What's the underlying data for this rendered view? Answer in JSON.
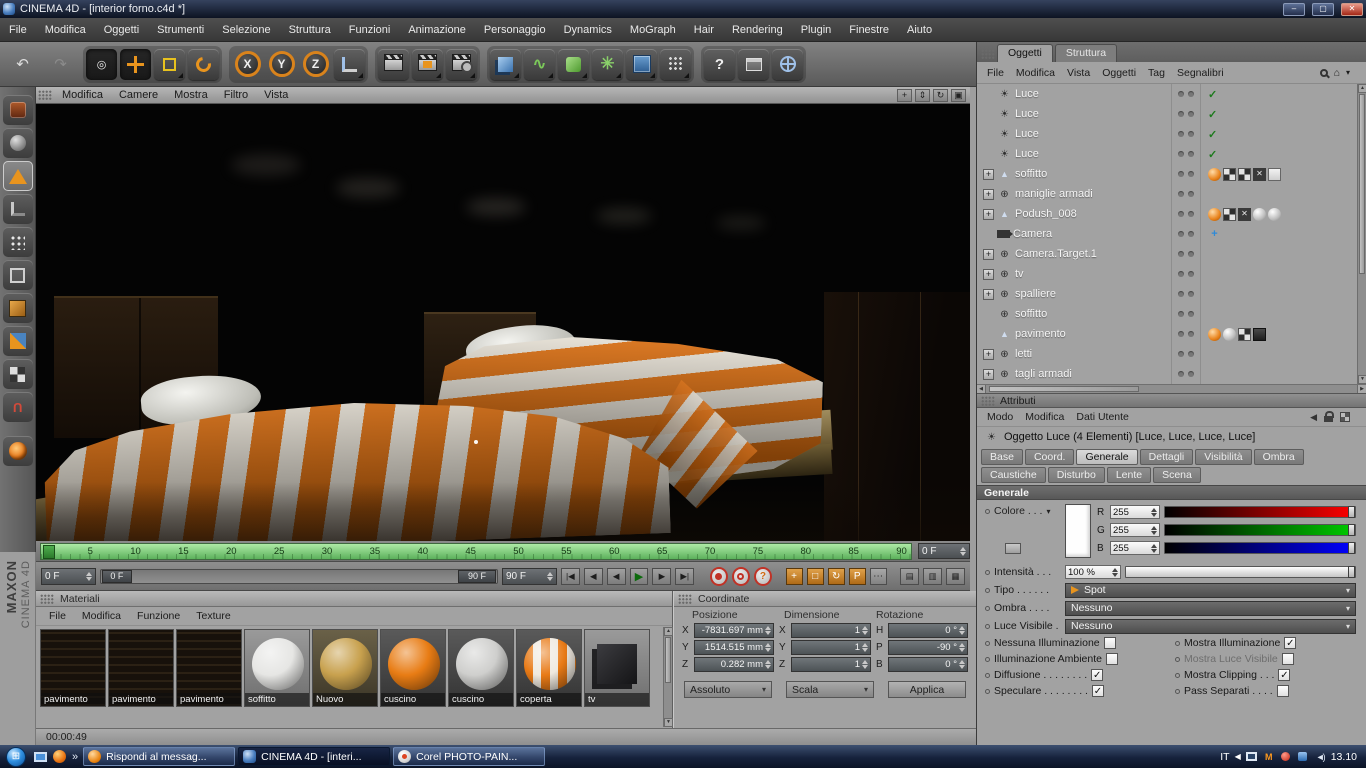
{
  "window": {
    "title": "CINEMA 4D - [interior forno.c4d *]"
  },
  "menubar": {
    "items": [
      "File",
      "Modifica",
      "Oggetti",
      "Strumenti",
      "Selezione",
      "Struttura",
      "Funzioni",
      "Animazione",
      "Personaggio",
      "Dynamics",
      "MoGraph",
      "Hair",
      "Rendering",
      "Plugin",
      "Finestre",
      "Aiuto"
    ]
  },
  "toolbar": {
    "axis": [
      "X",
      "Y",
      "Z"
    ],
    "icons": [
      "undo-icon",
      "redo-icon",
      "live-selection-icon",
      "move-icon",
      "scale-icon",
      "rotate-icon",
      "lock-x-icon",
      "lock-y-icon",
      "lock-z-icon",
      "coordinate-system-icon",
      "render-view-icon",
      "render-picture-viewer-icon",
      "render-settings-icon",
      "add-cube-icon",
      "add-spline-icon",
      "add-generator-icon",
      "add-deformer-icon",
      "add-ffd-icon",
      "add-environment-icon",
      "help-icon",
      "content-browser-icon",
      "online-help-icon"
    ]
  },
  "left_toolbar": {
    "icons": [
      "make-editable-icon",
      "model-mode-icon",
      "texture-axis-mode-icon",
      "object-axis-mode-icon",
      "points-mode-icon",
      "edges-mode-icon",
      "polygons-mode-icon",
      "animation-mode-icon",
      "texture-mode-icon",
      "snap-icon",
      "c4d-swirl-icon"
    ]
  },
  "viewport": {
    "menu": [
      "Modifica",
      "Camere",
      "Mostra",
      "Filtro",
      "Vista"
    ],
    "nav_icons": [
      "pan-view-icon",
      "dolly-view-icon",
      "rotate-view-icon",
      "toggle-views-icon"
    ]
  },
  "timeline": {
    "ticks": [
      "0",
      "5",
      "10",
      "15",
      "20",
      "25",
      "30",
      "35",
      "40",
      "45",
      "50",
      "55",
      "60",
      "65",
      "70",
      "75",
      "80",
      "85",
      "90"
    ],
    "frame_field": "0 F"
  },
  "transport": {
    "start_field": "0 F",
    "end_field": "90 F",
    "range_start": "0 F",
    "range_end": "90 F"
  },
  "materials": {
    "title": "Materiali",
    "menu": [
      "File",
      "Modifica",
      "Funzione",
      "Texture"
    ],
    "items": [
      {
        "name": "pavimento"
      },
      {
        "name": "pavimento"
      },
      {
        "name": "pavimento"
      },
      {
        "name": "soffitto"
      },
      {
        "name": "Nuovo"
      },
      {
        "name": "cuscino"
      },
      {
        "name": "cuscino"
      },
      {
        "name": "coperta"
      },
      {
        "name": "tv"
      }
    ]
  },
  "coordinates": {
    "title": "Coordinate",
    "columns": [
      "Posizione",
      "Dimensione",
      "Rotazione"
    ],
    "pos_labels": [
      "X",
      "Y",
      "Z"
    ],
    "dim_labels": [
      "X",
      "Y",
      "Z"
    ],
    "rot_labels": [
      "H",
      "P",
      "B"
    ],
    "pos_values": [
      "-7831.697 mm",
      "1514.515 mm",
      "0.282 mm"
    ],
    "dim_values": [
      "1",
      "1",
      "1"
    ],
    "rot_values": [
      "0 °",
      "-90 °",
      "0 °"
    ],
    "mode_position": "Assoluto",
    "mode_scale": "Scala",
    "apply": "Applica"
  },
  "objects": {
    "tabs": [
      "Oggetti",
      "Struttura"
    ],
    "menu": [
      "File",
      "Modifica",
      "Vista",
      "Oggetti",
      "Tag",
      "Segnalibri"
    ],
    "items": [
      {
        "name": "Luce",
        "icon": "light-object"
      },
      {
        "name": "Luce",
        "icon": "light-object"
      },
      {
        "name": "Luce",
        "icon": "light-object"
      },
      {
        "name": "Luce",
        "icon": "light-object"
      },
      {
        "name": "soffitto",
        "icon": "polygon-object",
        "expandable": true,
        "tags": [
          "phong",
          "uvw",
          "uvw",
          "x",
          "texture"
        ]
      },
      {
        "name": "maniglie armadi",
        "icon": "null-object",
        "expandable": true
      },
      {
        "name": "Podush_008",
        "icon": "polygon-object",
        "expandable": true,
        "tags": [
          "phong",
          "uvw",
          "x",
          "material",
          "material"
        ]
      },
      {
        "name": "Camera",
        "icon": "camera-object",
        "tags": [
          "target"
        ]
      },
      {
        "name": "Camera.Target.1",
        "icon": "null-object",
        "expandable": true
      },
      {
        "name": "tv",
        "icon": "null-object",
        "expandable": true
      },
      {
        "name": "spalliere",
        "icon": "null-object",
        "expandable": true
      },
      {
        "name": "soffitto",
        "icon": "null-object"
      },
      {
        "name": "pavimento",
        "icon": "polygon-object",
        "tags": [
          "phong",
          "material",
          "uvw",
          "texture-dark"
        ]
      },
      {
        "name": "letti",
        "icon": "null-object",
        "expandable": true
      },
      {
        "name": "tagli armadi",
        "icon": "null-object",
        "expandable": true
      }
    ]
  },
  "attributes": {
    "title": "Attributi",
    "menu": [
      "Modo",
      "Modifica",
      "Dati Utente"
    ],
    "object_label": "Oggetto Luce (4 Elementi) [Luce, Luce, Luce, Luce]",
    "tabs_row1": [
      "Base",
      "Coord.",
      "Generale",
      "Dettagli",
      "Visibilità",
      "Ombra",
      "Caustiche"
    ],
    "tabs_row2": [
      "Disturbo",
      "Lente",
      "Scena"
    ],
    "active_tab": "Generale",
    "section": "Generale",
    "color": {
      "label": "Colore . . .",
      "channels": [
        {
          "label": "R",
          "value": "255"
        },
        {
          "label": "G",
          "value": "255"
        },
        {
          "label": "B",
          "value": "255"
        }
      ]
    },
    "intensity": {
      "label": "Intensità . . .",
      "value": "100 %"
    },
    "tipo": {
      "label": "Tipo . . . . . .",
      "value": "Spot"
    },
    "ombra": {
      "label": "Ombra . . . .",
      "value": "Nessuno"
    },
    "luce_visibile": {
      "label": "Luce Visibile .",
      "value": "Nessuno"
    },
    "checkboxes": [
      {
        "label": "Nessuna Illuminazione",
        "checked": false
      },
      {
        "label": "Mostra Illuminazione",
        "checked": true
      },
      {
        "label": "Illuminazione Ambiente",
        "checked": false
      },
      {
        "label": "Mostra Luce Visibile",
        "checked": false,
        "disabled": true
      },
      {
        "label": "Diffusione . . . . . . . .",
        "checked": true
      },
      {
        "label": "Mostra Clipping . . .",
        "checked": true
      },
      {
        "label": "Speculare . . . . . . . .",
        "checked": true
      },
      {
        "label": "Pass Separati . . . .",
        "checked": false
      }
    ]
  },
  "status": {
    "render_time": "00:00:49"
  },
  "branding": {
    "maxon": "MAXON",
    "cinema": "CINEMA 4D"
  },
  "taskbar": {
    "apps": [
      {
        "label": "Rispondi al messag...",
        "icon": "messenger-icon"
      },
      {
        "label": "CINEMA 4D - [interi...",
        "icon": "cinema4d-icon",
        "active": true
      },
      {
        "label": "Corel PHOTO-PAIN...",
        "icon": "corel-icon"
      }
    ],
    "tray": {
      "lang": "IT",
      "clock": "13.10"
    }
  },
  "glyphs": {
    "check": "✓",
    "caret": "▾",
    "undo": "↶",
    "redo": "↷",
    "plus": "+",
    "pan": "+",
    "dolly": "⇕",
    "rotate_view": "↻",
    "frame_view": "▣",
    "home": "⌂",
    "goto_start": "|◀",
    "step_back": "◀",
    "play_rev": "◀",
    "play": "▶",
    "step_fwd": "▶",
    "goto_end": "▶|",
    "overflow": "»",
    "win_min": "–",
    "win_max": "▢",
    "win_close": "✕",
    "left": "◀",
    "right": "▶",
    "up": "▲",
    "down": "▼",
    "question": "?",
    "light": "☀",
    "nullobj": "⊕",
    "poly": "▲",
    "target": "+",
    "kpos": "+",
    "kscale": "□",
    "krot": "↻",
    "kparam": "P",
    "kpla": "⋯",
    "panel1": "▤",
    "panel2": "▥",
    "panel3": "▦",
    "spot_q": "?",
    "win_flag": "⊞",
    "speaker": "◄)"
  }
}
